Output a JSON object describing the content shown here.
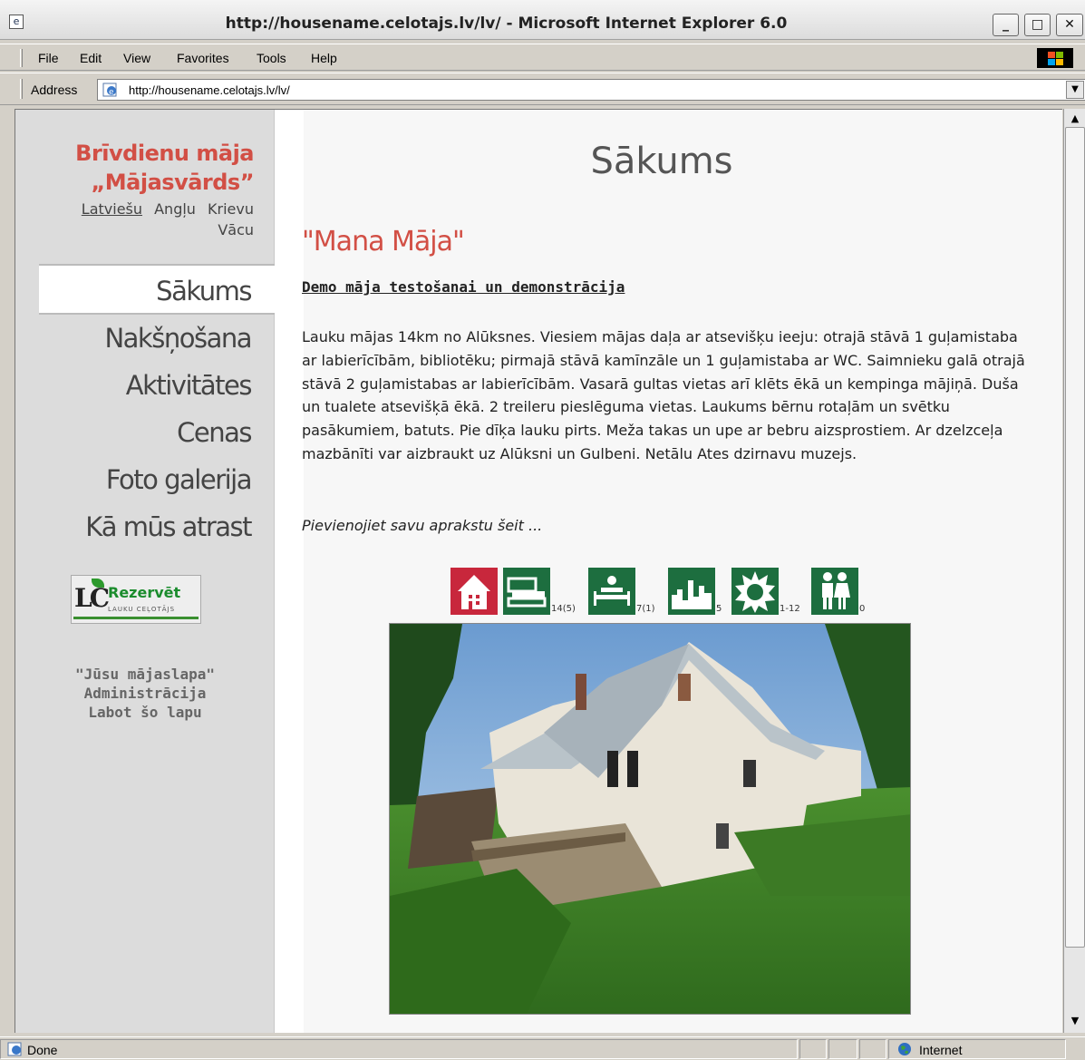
{
  "window": {
    "title": "http://housename.celotajs.lv/lv/ - Microsoft Internet Explorer 6.0",
    "app_icon": "ie-icon",
    "controls": {
      "minimize": "_",
      "maximize": "□",
      "close": "✕"
    }
  },
  "menu": {
    "items": [
      "File",
      "Edit",
      "View",
      "Favorites",
      "Tools",
      "Help"
    ]
  },
  "address": {
    "label": "Address",
    "url": "http://housename.celotajs.lv/lv/"
  },
  "sidebar": {
    "site_name_line1": "Brīvdienu māja",
    "site_name_line2": "„Mājasvārds”",
    "languages": [
      "Latviešu",
      "Angļu",
      "Krievu",
      "Vācu"
    ],
    "active_language": "Latviešu",
    "nav": [
      "Sākums",
      "Nakšņošana",
      "Aktivitātes",
      "Cenas",
      "Foto galerija",
      "Kā mūs atrast"
    ],
    "active_nav": "Sākums",
    "reserve": {
      "label": "Rezervēt",
      "sub": "LAUKU CEĻOTĀJS",
      "logo": "LC"
    },
    "admin_links": [
      "\"Jūsu mājaslapa\"",
      "Administrācija",
      "Labot šo lapu"
    ]
  },
  "main": {
    "page_title": "Sākums",
    "house_name": "\"Mana Māja\"",
    "subtitle": "Demo māja testošanai un demonstrācija",
    "description": "Lauku mājas 14km no Alūksnes. Viesiem mājas daļa ar atsevišķu ieeju:  otrajā stāvā  1 guļamistaba ar labierīcībām, bibliotēku; pirmajā stāvā kamīnzāle un 1 guļamistaba ar WC. Saimnieku galā otrajā stāvā 2 guļamistabas ar labierīcībām. Vasarā gultas vietas arī klēts ēkā un kempinga mājiņā. Duša un tualete atsevišķā ēkā. 2 treileru pieslēguma vietas. Laukums bērnu rotaļām un svētku pasākumiem, batuts. Pie dīķa lauku pirts. Meža takas un upe ar bebru aizsprostiem. Ar dzelzceļa mazbānīti var aizbraukt uz Alūksni un Gulbeni. Netālu Ates dzirnavu muzejs.",
    "add_note": "Pievienojiet savu aprakstu šeit ...",
    "icons": [
      {
        "name": "house-icon",
        "glyph": "🏠",
        "count": "",
        "color": "#c8273c"
      },
      {
        "name": "beds-icon",
        "glyph": "🛏",
        "count": "14(5)",
        "color": "#1d6e3f"
      },
      {
        "name": "extra-bed-icon",
        "glyph": "🛌",
        "count": "7(1)",
        "color": "#1d6e3f"
      },
      {
        "name": "rooms-icon",
        "glyph": "▙",
        "count": "5",
        "color": "#1d6e3f"
      },
      {
        "name": "sun-icon",
        "glyph": "✹",
        "count": "1-12",
        "color": "#1d6e3f"
      },
      {
        "name": "people-icon",
        "glyph": "👫",
        "count": "0",
        "color": "#1d6e3f"
      }
    ],
    "photo_alt": "house-photo"
  },
  "status": {
    "text": "Done",
    "zone": "Internet"
  },
  "colors": {
    "accent": "#d24f45",
    "icon_green": "#1d6e3f",
    "icon_red": "#c8273c"
  }
}
